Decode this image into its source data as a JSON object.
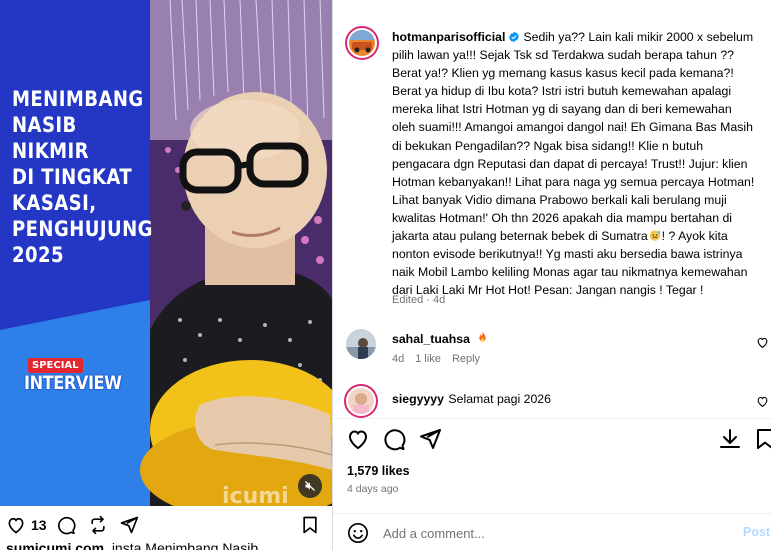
{
  "post": {
    "headline": "MENIMBANG\nNASIB\nNIKMIR\nDI TINGKAT\nKASASI,\nPENGHUJUNG\n2025",
    "badge_top": "SPECIAL",
    "badge_main": "INTERVIEW",
    "watermark": "icumi",
    "like_count": "13",
    "caption_user": "sumicumi.com",
    "caption_text": "_insta Menimbang Nasib..."
  },
  "caption": {
    "username": "hotmanparisofficial",
    "text": "Sedih ya?? Lain kali mikir 2000 x sebelum pilih lawan ya!!! Sejak Tsk sd Terdakwa sudah berapa tahun ?? Berat ya!? Klien yg memang kasus kasus kecil pada kemana?! Berat ya hidup di Ibu kota? Istri istri butuh kemewahan apalagi mereka lihat Istri Hotman yg di sayang dan di beri kemewahan oleh suami!!! Amangoi amangoi dangol nai! Eh Gimana Bas Masih di bekukan Pengadilan?? Ngak bisa sidang!! Klie n butuh pengacara dgn Reputasi dan dapat di percaya! Trust!! Jujur: klien Hotman kebanyakan!! Lihat para naga yg semua percaya Hotman! Lihat banyak Vidio dimana Prabowo berkali kali berulang muji kwalitas Hotman!' Oh thn 2026 apakah dia mampu bertahan di jakarta atau pulang beternak bebek di Sumatra",
    "text_end": "! ? Ayok kita nonton evisode berikutnya!! Yg masti aku bersedia bawa istrinya naik Mobil Lambo keliling Monas agar tau nikmatnya kemewahan dari Laki Laki Mr Hot Hot! Pesan: Jangan nangis ! Tegar !",
    "edited_label": "Edited",
    "edited_sep": " · ",
    "edited_time": "4d"
  },
  "comments": [
    {
      "username": "sahal_tuahsa",
      "text": "",
      "time": "4d",
      "likes": "1 like",
      "reply": "Reply"
    },
    {
      "username": "siegyyyy",
      "text": "Selamat pagi 2026"
    }
  ],
  "footer": {
    "likes": "1,579 likes",
    "time_ago": "4 days ago",
    "comment_placeholder": "Add a comment...",
    "post_label": "Post"
  },
  "colors": {
    "brand_blue": "#0095f6",
    "post_disabled": "#b3dbff",
    "muted": "#737373",
    "fire": "#f36b1c"
  }
}
